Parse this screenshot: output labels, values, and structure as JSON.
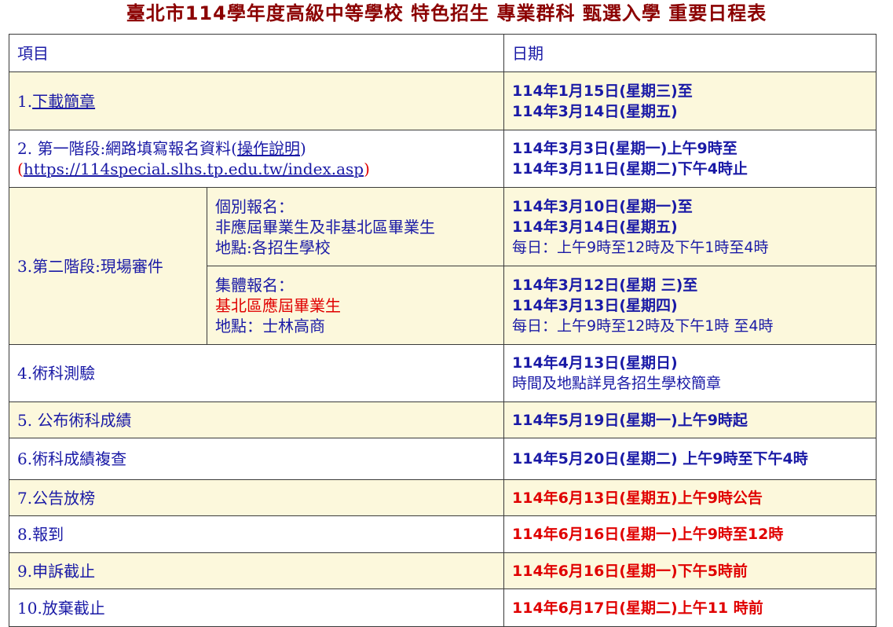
{
  "title": "臺北市114學年度高級中等學校 特色招生 專業群科 甄選入學 重要日程表",
  "header": {
    "item": "項目",
    "date": "日期"
  },
  "rows": {
    "r1": {
      "num": "1.",
      "label": "下載簡章",
      "d1": "114年1月15日(星期三)至",
      "d2": "114年3月14日(星期五)"
    },
    "r2": {
      "label1a": "2. 第一階段:網路填寫報名資料(",
      "label1b": "操作說明",
      "label1c": ")",
      "label2a": "(",
      "label2b": "https://114special.slhs.tp.edu.tw/index.asp",
      "label2c": ")",
      "d1": "114年3月3日(星期一)上午9時至",
      "d2": "114年3月11日(星期二)下午4時止"
    },
    "r3": {
      "label": "3.第二階段:現場審件",
      "sub1": {
        "l1": "個別報名：",
        "l2": "非應屆畢業生及非基北區畢業生",
        "l3": "地點:各招生學校",
        "d1": "114年3月10日(星期一)至",
        "d2": "114年3月14日(星期五)",
        "d3": "每日：上午9時至12時及下午1時至4時"
      },
      "sub2": {
        "l1": "集體報名：",
        "l2": "基北區應屆畢業生",
        "l3": "地點：士林高商",
        "d1": "114年3月12日(星期 三)至",
        "d2": "114年3月13日(星期四)",
        "d3": "每日：上午9時至12時及下午1時 至4時"
      }
    },
    "r4": {
      "label": "4.術科測驗",
      "d1": "114年4月13日(星期日)",
      "d2": "時間及地點詳見各招生學校簡章"
    },
    "r5": {
      "label": "5. 公布術科成績",
      "d1": "114年5月19日(星期一)上午9時起"
    },
    "r6": {
      "label": "6.術科成績複查",
      "d1": "114年5月20日(星期二) 上午9時至下午4時"
    },
    "r7": {
      "label": "7.公告放榜",
      "d1": "114年6月13日(星期五)上午9時公告"
    },
    "r8": {
      "label": "8.報到",
      "d1": "114年6月16日(星期一)上午9時至12時"
    },
    "r9": {
      "label": "9.申訴截止",
      "d1": "114年6月16日(星期一)下午5時前"
    },
    "r10": {
      "label": "10.放棄截止",
      "d1": "114年6月17日(星期二)上午11 時前"
    }
  },
  "colors": {
    "title": "#8b0000",
    "text": "#1a1aa6",
    "highlight": "#e00000",
    "shade": "#fcf8dc"
  }
}
